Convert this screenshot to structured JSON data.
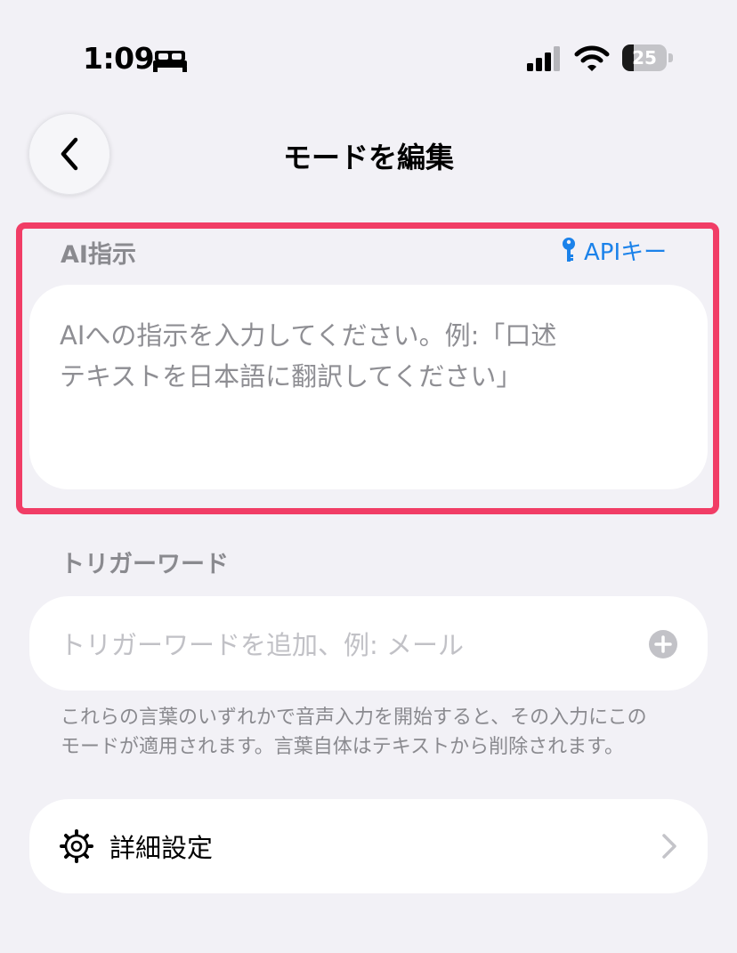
{
  "status_bar": {
    "time": "1:09",
    "battery_level": "25",
    "battery_fraction": 0.25,
    "icons": [
      "sleep-icon",
      "signal-icon",
      "wifi-icon",
      "battery-icon"
    ]
  },
  "header": {
    "title": "モードを編集",
    "back_icon": "chevron-left-icon"
  },
  "ai_instruction": {
    "label": "AI指示",
    "api_link": "APIキー",
    "api_icon": "key-icon",
    "placeholder": "AIへの指示を入力してください。例:「口述テキストを日本語に翻訳してください」",
    "placeholder_line1": "AIへの指示を入力してください。例:「口述",
    "placeholder_line2": "テキストを日本語に翻訳してください」",
    "highlight_color": "#f13d66"
  },
  "trigger_words": {
    "label": "トリガーワード",
    "placeholder": "トリガーワードを追加、例: メール",
    "add_icon": "plus-circle-icon",
    "helper_line1": "これらの言葉のいずれかで音声入力を開始すると、その入力にこの",
    "helper_line2": "モードが適用されます。言葉自体はテキストから削除されます。"
  },
  "advanced": {
    "label": "詳細設定",
    "icon": "gear-icon",
    "chevron": "chevron-right-icon"
  },
  "colors": {
    "background": "#f2f1f6",
    "accent": "#1b82ea",
    "secondary_text": "#8a8a8f"
  }
}
